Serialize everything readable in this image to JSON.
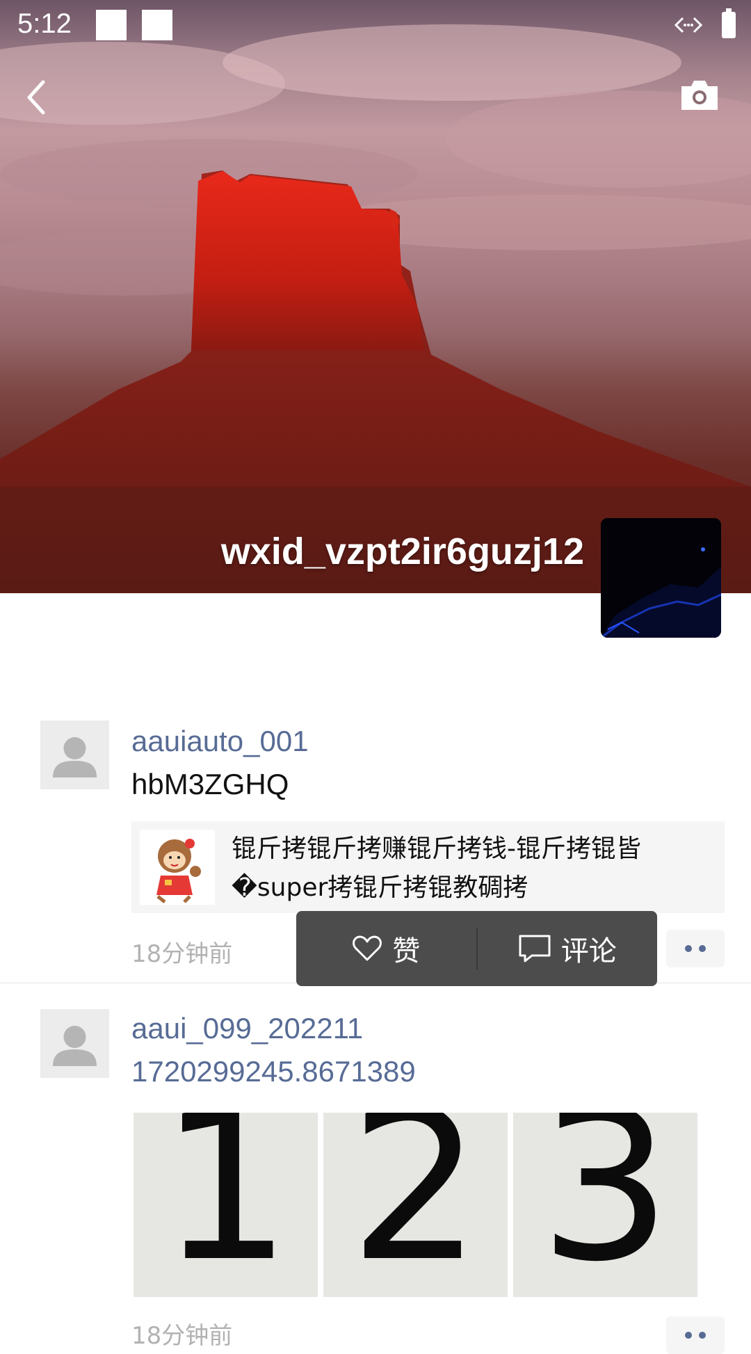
{
  "status_bar": {
    "time": "5:12"
  },
  "cover": {
    "name": "wxid_vzpt2ir6guzj12"
  },
  "posts": [
    {
      "author": "aauiauto_001",
      "text": "hbM3ZGHQ",
      "share_title": "锟斤拷锟斤拷赚锟斤拷钱-锟斤拷锟皆�super拷锟斤拷锟教碉拷",
      "time": "18分钟前"
    },
    {
      "author": "aaui_099_202211",
      "text": "1720299245.8671389",
      "photos": [
        "1",
        "2",
        "3"
      ],
      "time": "18分钟前"
    }
  ],
  "actions": {
    "like": "赞",
    "comment": "评论"
  }
}
